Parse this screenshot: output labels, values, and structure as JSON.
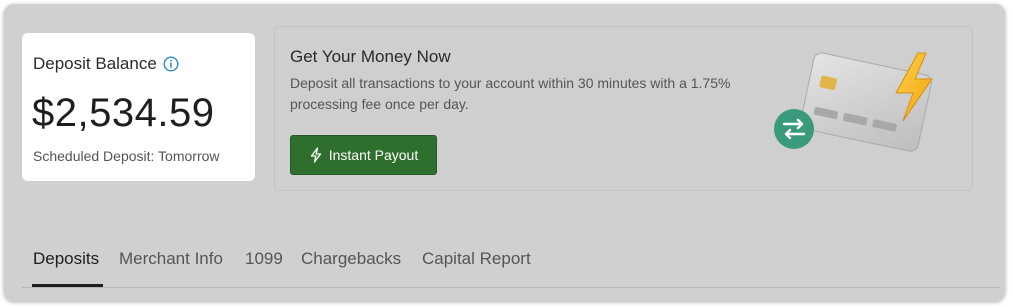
{
  "balance": {
    "title": "Deposit Balance",
    "amount": "$2,534.59",
    "subtitle": "Scheduled Deposit: Tomorrow"
  },
  "promo": {
    "title": "Get Your Money Now",
    "body": "Deposit all transactions to your account within 30 minutes with a 1.75% processing fee once per day.",
    "button_label": "Instant Payout"
  },
  "tabs": [
    {
      "label": "Deposits",
      "active": true
    },
    {
      "label": "Merchant Info",
      "active": false
    },
    {
      "label": "1099",
      "active": false
    },
    {
      "label": "Chargebacks",
      "active": false
    },
    {
      "label": "Capital Report",
      "active": false
    }
  ],
  "colors": {
    "accent_blue": "#2b8cc4",
    "button_green": "#2e6f2e",
    "transfer_teal": "#3a9a7c",
    "bolt_yellow": "#f4b51f"
  },
  "icons": [
    "info-icon",
    "lightning-bolt-icon",
    "credit-card-illustration",
    "transfer-arrows-icon"
  ]
}
